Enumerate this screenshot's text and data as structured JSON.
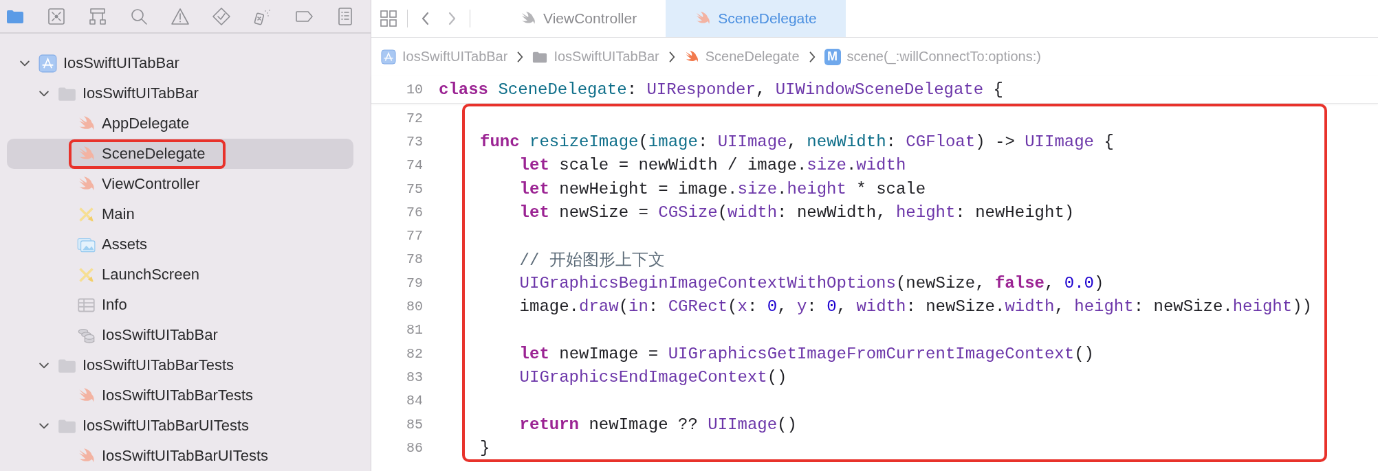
{
  "navigator_tabs": [
    {
      "kind": "folder",
      "selected": true
    },
    {
      "kind": "source-control",
      "selected": false
    },
    {
      "kind": "hierarchy",
      "selected": false
    },
    {
      "kind": "search",
      "selected": false
    },
    {
      "kind": "warning",
      "selected": false
    },
    {
      "kind": "test",
      "selected": false
    },
    {
      "kind": "debug",
      "selected": false
    },
    {
      "kind": "tag",
      "selected": false
    },
    {
      "kind": "report",
      "selected": false
    }
  ],
  "tree": [
    {
      "label": "IosSwiftUITabBar",
      "kind": "project",
      "expanded": true,
      "selected": false,
      "highlighted": false,
      "children": [
        {
          "label": "IosSwiftUITabBar",
          "kind": "folder",
          "expanded": true,
          "selected": false,
          "highlighted": false,
          "children": [
            {
              "label": "AppDelegate",
              "kind": "swift",
              "selected": false,
              "highlighted": false
            },
            {
              "label": "SceneDelegate",
              "kind": "swift",
              "selected": true,
              "highlighted": true
            },
            {
              "label": "ViewController",
              "kind": "swift",
              "selected": false,
              "highlighted": false
            },
            {
              "label": "Main",
              "kind": "storyboard",
              "selected": false,
              "highlighted": false
            },
            {
              "label": "Assets",
              "kind": "assets",
              "selected": false,
              "highlighted": false
            },
            {
              "label": "LaunchScreen",
              "kind": "storyboard",
              "selected": false,
              "highlighted": false
            },
            {
              "label": "Info",
              "kind": "plist",
              "selected": false,
              "highlighted": false
            },
            {
              "label": "IosSwiftUITabBar",
              "kind": "datamodel",
              "selected": false,
              "highlighted": false
            }
          ]
        },
        {
          "label": "IosSwiftUITabBarTests",
          "kind": "folder",
          "expanded": true,
          "selected": false,
          "highlighted": false,
          "children": [
            {
              "label": "IosSwiftUITabBarTests",
              "kind": "swift",
              "selected": false,
              "highlighted": false
            }
          ]
        },
        {
          "label": "IosSwiftUITabBarUITests",
          "kind": "folder",
          "expanded": true,
          "selected": false,
          "highlighted": false,
          "children": [
            {
              "label": "IosSwiftUITabBarUITests",
              "kind": "swift",
              "selected": false,
              "highlighted": false
            }
          ]
        }
      ]
    }
  ],
  "tabs": [
    {
      "label": "ViewController",
      "selected": false
    },
    {
      "label": "SceneDelegate",
      "selected": true
    }
  ],
  "breadcrumb": [
    {
      "label": "IosSwiftUITabBar",
      "kind": "project"
    },
    {
      "label": "IosSwiftUITabBar",
      "kind": "folder"
    },
    {
      "label": "SceneDelegate",
      "kind": "swift"
    },
    {
      "label": "scene(_:willConnectTo:options:)",
      "kind": "method",
      "badge": "M"
    }
  ],
  "code": {
    "highlighted": true,
    "header_line": {
      "number": "10",
      "tokens": [
        {
          "kind": "keyword",
          "text": "class "
        },
        {
          "kind": "decl",
          "text": "SceneDelegate"
        },
        {
          "kind": "plain",
          "text": ": "
        },
        {
          "kind": "type",
          "text": "UIResponder"
        },
        {
          "kind": "plain",
          "text": ", "
        },
        {
          "kind": "type",
          "text": "UIWindowSceneDelegate"
        },
        {
          "kind": "plain",
          "text": " {"
        }
      ]
    },
    "lines": [
      {
        "number": "72"
      },
      {
        "number": "73",
        "tokens": [
          {
            "kind": "keyword",
            "text": "func "
          },
          {
            "kind": "decl",
            "text": "resizeImage"
          },
          {
            "kind": "plain",
            "text": "("
          },
          {
            "kind": "decl",
            "text": "image"
          },
          {
            "kind": "plain",
            "text": ": "
          },
          {
            "kind": "type",
            "text": "UIImage"
          },
          {
            "kind": "plain",
            "text": ", "
          },
          {
            "kind": "decl",
            "text": "newWidth"
          },
          {
            "kind": "plain",
            "text": ": "
          },
          {
            "kind": "type",
            "text": "CGFloat"
          },
          {
            "kind": "plain",
            "text": ") -> "
          },
          {
            "kind": "type",
            "text": "UIImage"
          },
          {
            "kind": "plain",
            "text": " {"
          }
        ]
      },
      {
        "number": "74",
        "tokens": [
          {
            "kind": "keyword",
            "text": "    let"
          },
          {
            "kind": "plain",
            "text": " scale = newWidth / image."
          },
          {
            "kind": "member",
            "text": "size"
          },
          {
            "kind": "plain",
            "text": "."
          },
          {
            "kind": "member",
            "text": "width"
          }
        ]
      },
      {
        "number": "75",
        "tokens": [
          {
            "kind": "keyword",
            "text": "    let"
          },
          {
            "kind": "plain",
            "text": " newHeight = image."
          },
          {
            "kind": "member",
            "text": "size"
          },
          {
            "kind": "plain",
            "text": "."
          },
          {
            "kind": "member",
            "text": "height"
          },
          {
            "kind": "plain",
            "text": " * scale"
          }
        ]
      },
      {
        "number": "76",
        "tokens": [
          {
            "kind": "keyword",
            "text": "    let"
          },
          {
            "kind": "plain",
            "text": " newSize = "
          },
          {
            "kind": "type",
            "text": "CGSize"
          },
          {
            "kind": "plain",
            "text": "("
          },
          {
            "kind": "member",
            "text": "width"
          },
          {
            "kind": "plain",
            "text": ": newWidth, "
          },
          {
            "kind": "member",
            "text": "height"
          },
          {
            "kind": "plain",
            "text": ": newHeight)"
          }
        ]
      },
      {
        "number": "77"
      },
      {
        "number": "78",
        "tokens": [
          {
            "kind": "comment",
            "text": "    // 开始图形上下文"
          }
        ]
      },
      {
        "number": "79",
        "tokens": [
          {
            "kind": "type",
            "text": "    UIGraphicsBeginImageContextWithOptions"
          },
          {
            "kind": "plain",
            "text": "(newSize, "
          },
          {
            "kind": "keyword",
            "text": "false"
          },
          {
            "kind": "plain",
            "text": ", "
          },
          {
            "kind": "number",
            "text": "0.0"
          },
          {
            "kind": "plain",
            "text": ")"
          }
        ]
      },
      {
        "number": "80",
        "tokens": [
          {
            "kind": "plain",
            "text": "    image."
          },
          {
            "kind": "member",
            "text": "draw"
          },
          {
            "kind": "plain",
            "text": "("
          },
          {
            "kind": "member",
            "text": "in"
          },
          {
            "kind": "plain",
            "text": ": "
          },
          {
            "kind": "type",
            "text": "CGRect"
          },
          {
            "kind": "plain",
            "text": "("
          },
          {
            "kind": "member",
            "text": "x"
          },
          {
            "kind": "plain",
            "text": ": "
          },
          {
            "kind": "number",
            "text": "0"
          },
          {
            "kind": "plain",
            "text": ", "
          },
          {
            "kind": "member",
            "text": "y"
          },
          {
            "kind": "plain",
            "text": ": "
          },
          {
            "kind": "number",
            "text": "0"
          },
          {
            "kind": "plain",
            "text": ", "
          },
          {
            "kind": "member",
            "text": "width"
          },
          {
            "kind": "plain",
            "text": ": newSize."
          },
          {
            "kind": "member",
            "text": "width"
          },
          {
            "kind": "plain",
            "text": ", "
          },
          {
            "kind": "member",
            "text": "height"
          },
          {
            "kind": "plain",
            "text": ": newSize."
          },
          {
            "kind": "member",
            "text": "height"
          },
          {
            "kind": "plain",
            "text": "))"
          }
        ]
      },
      {
        "number": "81"
      },
      {
        "number": "82",
        "tokens": [
          {
            "kind": "keyword",
            "text": "    let"
          },
          {
            "kind": "plain",
            "text": " newImage = "
          },
          {
            "kind": "type",
            "text": "UIGraphicsGetImageFromCurrentImageContext"
          },
          {
            "kind": "plain",
            "text": "()"
          }
        ]
      },
      {
        "number": "83",
        "tokens": [
          {
            "kind": "type",
            "text": "    UIGraphicsEndImageContext"
          },
          {
            "kind": "plain",
            "text": "()"
          }
        ]
      },
      {
        "number": "84"
      },
      {
        "number": "85",
        "tokens": [
          {
            "kind": "keyword",
            "text": "    return"
          },
          {
            "kind": "plain",
            "text": " newImage ?? "
          },
          {
            "kind": "type",
            "text": "UIImage"
          },
          {
            "kind": "plain",
            "text": "()"
          }
        ]
      },
      {
        "number": "86",
        "tokens": [
          {
            "kind": "plain",
            "text": "}"
          }
        ]
      }
    ]
  }
}
